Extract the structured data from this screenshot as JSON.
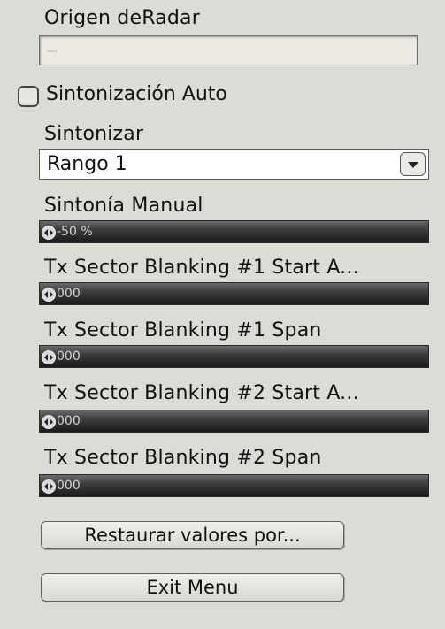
{
  "radar_origin": {
    "label": "Origen deRadar",
    "value": "---"
  },
  "auto_tune": {
    "label": "Sintonización Auto",
    "checked": false
  },
  "tune": {
    "label": "Sintonizar",
    "selected": "Rango 1"
  },
  "manual_tune": {
    "label": "Sintonía Manual",
    "value": "-50 %"
  },
  "sector1_start": {
    "label": "Tx Sector Blanking #1 Start A...",
    "value": "000"
  },
  "sector1_span": {
    "label": "Tx Sector Blanking #1 Span",
    "value": "000"
  },
  "sector2_start": {
    "label": "Tx Sector Blanking #2 Start A...",
    "value": "000"
  },
  "sector2_span": {
    "label": "Tx Sector Blanking #2 Span",
    "value": "000"
  },
  "buttons": {
    "restore": "Restaurar valores por...",
    "exit": "Exit Menu"
  }
}
